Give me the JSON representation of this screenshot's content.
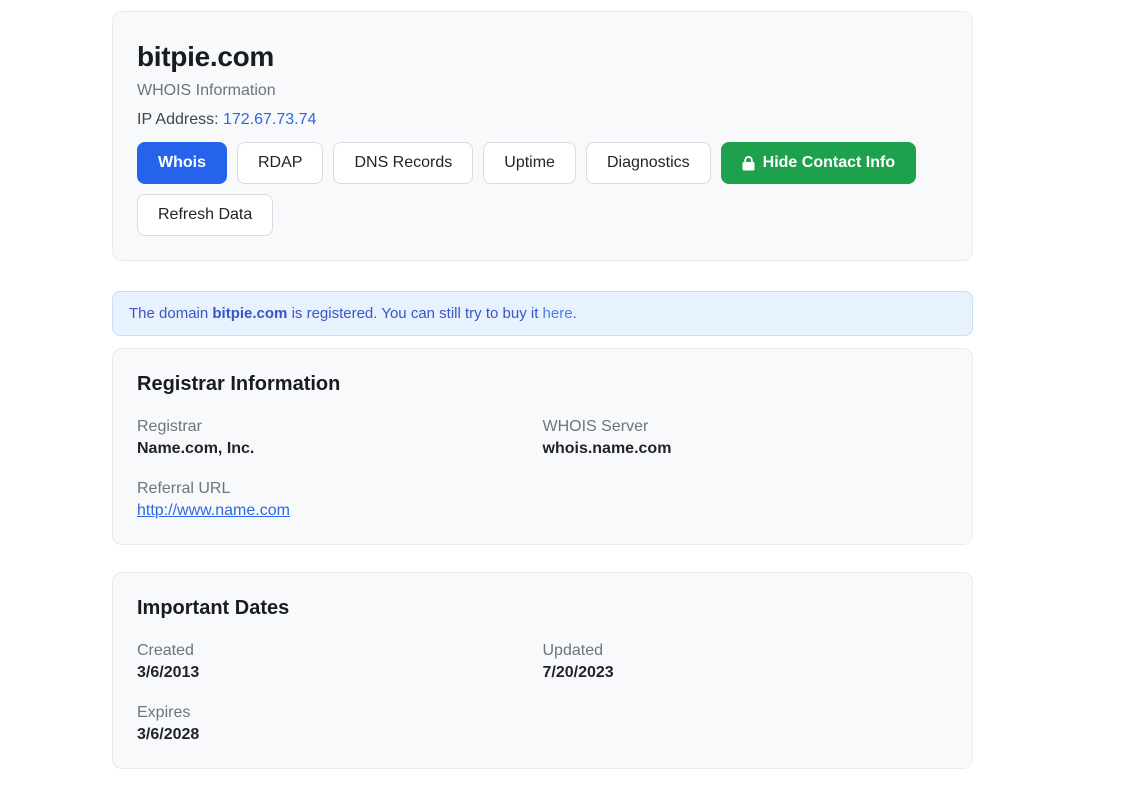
{
  "header": {
    "domain": "bitpie.com",
    "subtitle": "WHOIS Information",
    "ip_label": "IP Address: ",
    "ip_address": "172.67.73.74"
  },
  "tabs": [
    {
      "label": "Whois",
      "active": true
    },
    {
      "label": "RDAP",
      "active": false
    },
    {
      "label": "DNS Records",
      "active": false
    },
    {
      "label": "Uptime",
      "active": false
    },
    {
      "label": "Diagnostics",
      "active": false
    }
  ],
  "actions": {
    "hide_contact_label": "Hide Contact Info",
    "hide_contact_icon": "lock-icon",
    "refresh_label": "Refresh Data"
  },
  "alert": {
    "prefix": "The domain ",
    "domain": "bitpie.com",
    "middle": " is registered. You can still try to buy it ",
    "link_text": "here",
    "suffix": "."
  },
  "registrar_card": {
    "title": "Registrar Information",
    "fields": [
      {
        "label": "Registrar",
        "value": "Name.com, Inc."
      },
      {
        "label": "WHOIS Server",
        "value": "whois.name.com"
      },
      {
        "label": "Referral URL",
        "value": "http://www.name.com",
        "is_link": true
      }
    ]
  },
  "dates_card": {
    "title": "Important Dates",
    "fields": [
      {
        "label": "Created",
        "value": "3/6/2013"
      },
      {
        "label": "Updated",
        "value": "7/20/2023"
      },
      {
        "label": "Expires",
        "value": "3/6/2028"
      }
    ]
  },
  "colors": {
    "primary_button": "#2563eb",
    "success_button": "#1ea14d",
    "link_blue": "#2f66e4",
    "alert_background": "#e8f1fe",
    "alert_text": "#3a55c5",
    "card_background": "#f8f9fa",
    "card_border": "#e9ecef",
    "muted_label": "#6c757d",
    "value_text": "#1f2329"
  }
}
